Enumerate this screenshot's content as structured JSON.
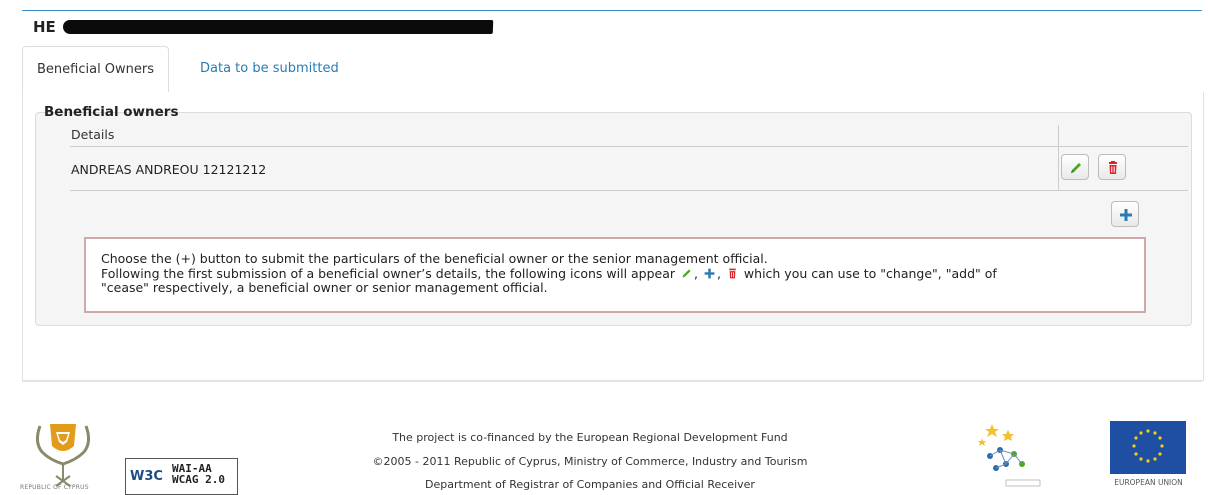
{
  "header": {
    "company_prefix": "HE"
  },
  "tabs": [
    {
      "label": "Beneficial Owners",
      "active": true
    },
    {
      "label": "Data to be submitted",
      "active": false
    }
  ],
  "section": {
    "legend": "Beneficial owners",
    "table": {
      "columns": [
        "Details"
      ],
      "rows": [
        {
          "details": "ANDREAS ANDREOU 12121212"
        }
      ]
    },
    "info": {
      "line1": "Choose the (+) button to submit the particulars of the beneficial owner or the senior management official.",
      "line2_before": "Following the first submission of a beneficial owner’s details, the following icons will appear",
      "line2_after": "which you can use to \"change\", \"add\" of",
      "line3": "\"cease\" respectively, a beneficial owner or senior management official."
    }
  },
  "icons": {
    "edit": "pencil-icon",
    "delete": "trash-icon",
    "add": "plus-icon"
  },
  "colors": {
    "link": "#2a7bb5",
    "edit_green": "#4aa826",
    "delete_red": "#d9252a",
    "add_blue": "#2a7bb5",
    "info_border": "#cfa9a9"
  },
  "footer": {
    "coat_caption": "REPUBLIC OF CYPRUS",
    "w3c_logo": "W3C",
    "wai_line1": "WAI-AA",
    "wai_line2": "WCAG 2.0",
    "line1": "The project is co-financed by the European Regional Development Fund",
    "line2": "©2005 - 2011 Republic of Cyprus, Ministry of Commerce, Industry and Tourism",
    "line3": "Department of Registrar of Companies and Official Receiver",
    "eu_caption": "EUROPEAN UNION"
  }
}
